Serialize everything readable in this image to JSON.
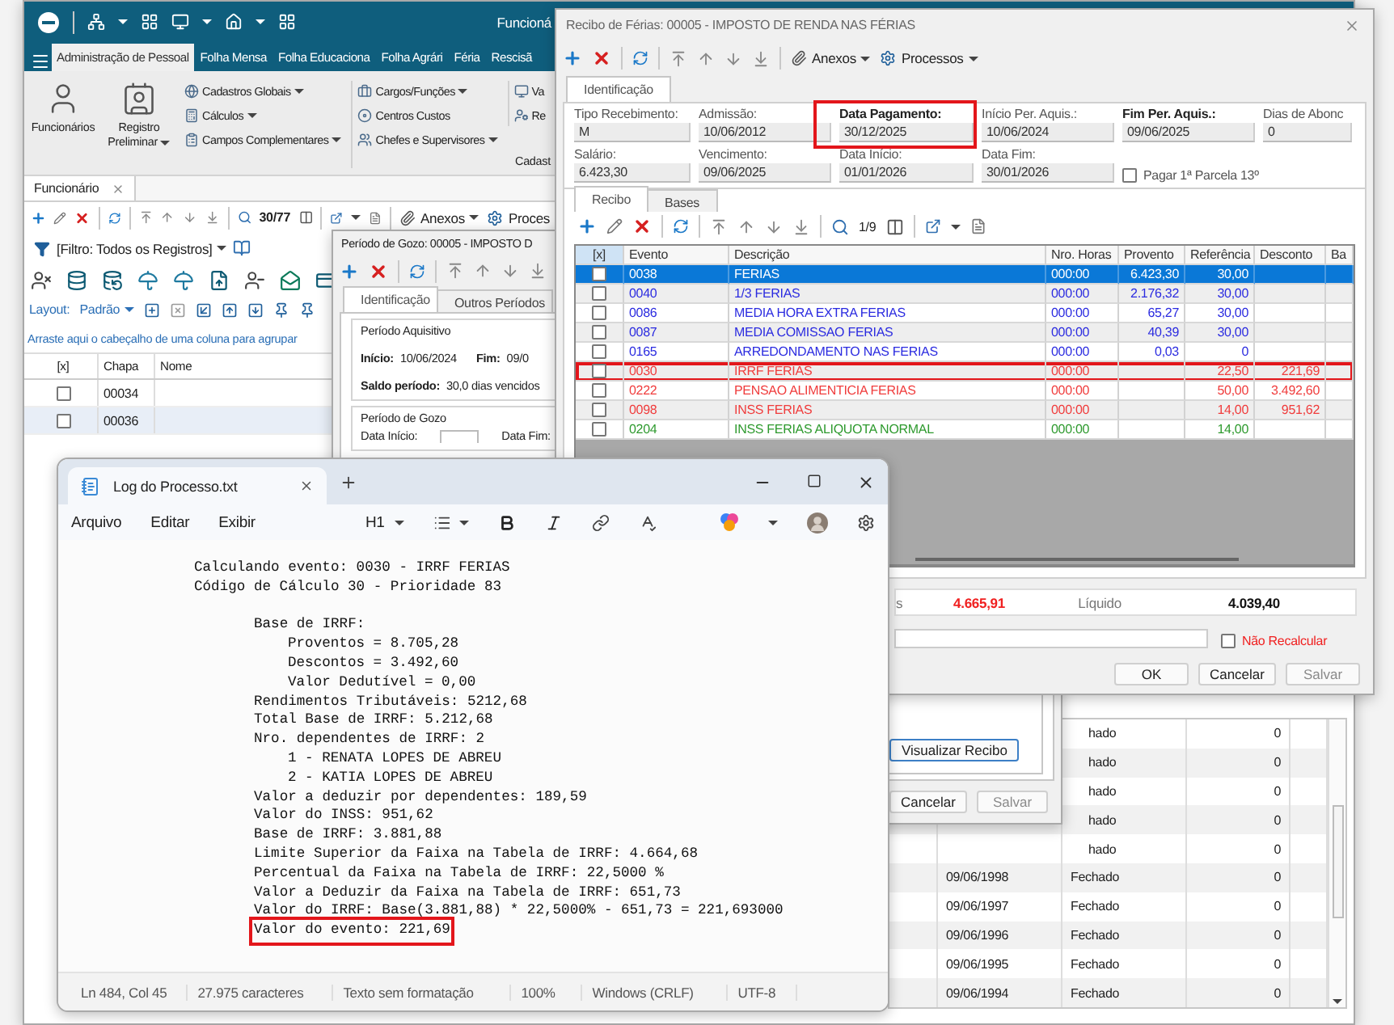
{
  "main_window": {
    "title": "Funcioná",
    "ribbon_tabs": [
      {
        "label": "Administração de Pessoal",
        "selected": true
      },
      {
        "label": "Folha Mensa",
        "selected": false
      },
      {
        "label": "Folha Educaciona",
        "selected": false
      },
      {
        "label": "Folha Agrári",
        "selected": false
      },
      {
        "label": "Féria",
        "selected": false
      },
      {
        "label": "Rescisã",
        "selected": false
      }
    ],
    "ribbon_buttons": [
      {
        "label": "Funcionários",
        "dropdown": false
      },
      {
        "label": "Registro Preliminar",
        "dropdown": true
      }
    ],
    "ribbon_columns": [
      {
        "items": [
          {
            "label": "Cadastros Globais",
            "dropdown": true
          },
          {
            "label": "Cálculos",
            "dropdown": true
          },
          {
            "label": "Campos Complementares",
            "dropdown": true
          }
        ]
      },
      {
        "items": [
          {
            "label": "Cargos/Funções",
            "dropdown": true
          },
          {
            "label": "Centros Custos",
            "dropdown": false
          },
          {
            "label": "Chefes e Supervisores",
            "dropdown": true
          }
        ]
      },
      {
        "items": [
          {
            "label": "Va",
            "dropdown": false
          },
          {
            "label": "Re",
            "dropdown": false
          }
        ]
      }
    ],
    "ribbon_group_label": "Cadast",
    "document_tab": "Funcionário",
    "toolbar": {
      "counter": "30/77",
      "attachments": "Anexos",
      "processes": "Proces"
    },
    "filter": "[Filtro: Todos os Registros]",
    "layout": {
      "label": "Layout:",
      "value": "Padrão"
    },
    "group_hint": "Arraste aqui o cabeçalho de uma coluna para agrupar",
    "grid": {
      "columns": [
        "[x]",
        "Chapa",
        "Nome"
      ],
      "rows": [
        {
          "chapa": "00034",
          "checked": false,
          "selected": false
        },
        {
          "chapa": "00036",
          "checked": false,
          "selected": true
        }
      ]
    },
    "periods": [
      {
        "kind": "cut",
        "status": "hado",
        "count": "0"
      },
      {
        "kind": "cut",
        "status": "hado",
        "count": "0"
      },
      {
        "kind": "cut",
        "status": "hado",
        "count": "0"
      },
      {
        "kind": "cut",
        "status": "hado",
        "count": "0"
      },
      {
        "kind": "cut",
        "status": "hado",
        "count": "0"
      },
      {
        "kind": "row",
        "date": "09/06/1998",
        "status": "Fechado",
        "count": "0"
      },
      {
        "kind": "row",
        "date": "09/06/1997",
        "status": "Fechado",
        "count": "0"
      },
      {
        "kind": "row",
        "date": "09/06/1996",
        "status": "Fechado",
        "count": "0"
      },
      {
        "kind": "row",
        "date": "09/06/1995",
        "status": "Fechado",
        "count": "0"
      },
      {
        "kind": "row",
        "date": "09/06/1994",
        "status": "Fechado",
        "count": "0"
      }
    ]
  },
  "period_window": {
    "title": "Período de Gozo: 00005 - IMPOSTO D",
    "tabs": [
      {
        "label": "Identificação",
        "selected": true
      },
      {
        "label": "Outros Períodos",
        "selected": false
      }
    ],
    "acquisition": {
      "title": "Período Aquisitivo",
      "start_label": "Início:",
      "start": "10/06/2024",
      "end_label": "Fim:",
      "end": "09/0",
      "balance_label": "Saldo período:",
      "balance": "30,0 dias vencidos"
    },
    "enjoyment": {
      "title": "Período de Gozo",
      "start_label": "Data Início:",
      "end_label": "Data Fim:"
    },
    "view_button": "Visualizar Recibo",
    "buttons": [
      {
        "label": "Cancelar",
        "disabled": false
      },
      {
        "label": "Salvar",
        "disabled": true
      }
    ]
  },
  "receipt_window": {
    "title": "Recibo de Férias: 00005 - IMPOSTO DE RENDA NAS FÉRIAS",
    "toolbar": {
      "attachments": "Anexos",
      "processes": "Processos"
    },
    "tab": "Identificação",
    "fields": [
      {
        "label": "Tipo Recebimento:",
        "value": "M",
        "bold": false,
        "highlighted": false
      },
      {
        "label": "Admissão:",
        "value": "10/06/2012",
        "bold": false,
        "highlighted": false
      },
      {
        "label": "Data Pagamento:",
        "value": "30/12/2025",
        "bold": true,
        "highlighted": true
      },
      {
        "label": "Início Per. Aquis.:",
        "value": "10/06/2024",
        "bold": false,
        "highlighted": false
      },
      {
        "label": "Fim Per. Aquis.:",
        "value": "09/06/2025",
        "bold": true,
        "highlighted": false
      },
      {
        "label": "Dias de Abonc",
        "value": "0",
        "bold": false,
        "highlighted": false
      },
      {
        "label": "Salário:",
        "value": "6.423,30",
        "bold": false,
        "highlighted": false
      },
      {
        "label": "Vencimento:",
        "value": "09/06/2025",
        "bold": false,
        "highlighted": false
      },
      {
        "label": "Data Início:",
        "value": "01/01/2026",
        "bold": false,
        "highlighted": false
      },
      {
        "label": "Data Fim:",
        "value": "30/01/2026",
        "bold": false,
        "highlighted": false
      }
    ],
    "first_installment": {
      "label": "Pagar 1ª Parcela 13º",
      "checked": false
    },
    "subtabs": [
      {
        "label": "Recibo",
        "selected": true
      },
      {
        "label": "Bases",
        "selected": false
      }
    ],
    "counter": "1/9",
    "columns": [
      "[x]",
      "Evento",
      "Descrição",
      "Nro. Horas",
      "Provento",
      "Referência",
      "Desconto",
      "Ba"
    ],
    "rows": [
      {
        "code": "0038",
        "description": "FERIAS",
        "hours": "000:00",
        "earning": "6.423,30",
        "reference": "30,00",
        "checked": false,
        "selected": true,
        "highlighted": false
      },
      {
        "code": "0040",
        "description": "1/3 FERIAS",
        "hours": "000:00",
        "earning": "2.176,32",
        "reference": "30,00",
        "color": "#2b2be0",
        "checked": false,
        "selected": false,
        "highlighted": false
      },
      {
        "code": "0086",
        "description": "MEDIA HORA EXTRA FERIAS",
        "hours": "000:00",
        "earning": "65,27",
        "reference": "30,00",
        "color": "#2b2be0",
        "checked": false,
        "selected": false,
        "highlighted": false
      },
      {
        "code": "0087",
        "description": "MEDIA COMISSAO FERIAS",
        "hours": "000:00",
        "earning": "40,39",
        "reference": "30,00",
        "color": "#2b2be0",
        "checked": false,
        "selected": false,
        "highlighted": false
      },
      {
        "code": "0165",
        "description": "ARREDONDAMENTO NAS FERIAS",
        "hours": "000:00",
        "earning": "0,03",
        "reference": "0",
        "color": "#2b2be0",
        "checked": false,
        "selected": false,
        "highlighted": false
      },
      {
        "code": "0030",
        "description": "IRRF FERIAS",
        "hours": "000:00",
        "reference": "22,50",
        "deduction": "221,69",
        "color": "#f03c3c",
        "checked": false,
        "selected": false,
        "highlighted": true
      },
      {
        "code": "0222",
        "description": "PENSAO ALIMENTICIA FERIAS",
        "hours": "000:00",
        "reference": "50,00",
        "deduction": "3.492,60",
        "color": "#f03c3c",
        "checked": false,
        "selected": false,
        "highlighted": false
      },
      {
        "code": "0098",
        "description": "INSS FERIAS",
        "hours": "000:00",
        "reference": "14,00",
        "deduction": "951,62",
        "color": "#f03c3c",
        "checked": false,
        "selected": false,
        "highlighted": false
      },
      {
        "code": "0204",
        "description": "INSS FERIAS ALIQUOTA NORMAL",
        "hours": "000:00",
        "reference": "14,00",
        "color": "#2e9a2e",
        "checked": false,
        "selected": false,
        "highlighted": false
      }
    ],
    "totals": [
      {
        "kind": "deduction",
        "label": "s",
        "value": "4.665,91"
      },
      {
        "kind": "net",
        "label": "Líquido",
        "value": "4.039,40"
      }
    ],
    "no_recalc": {
      "label": "Não Recalcular",
      "checked": false
    },
    "buttons": [
      {
        "label": "OK",
        "disabled": false
      },
      {
        "label": "Cancelar",
        "disabled": false
      },
      {
        "label": "Salvar",
        "disabled": true
      }
    ]
  },
  "notepad": {
    "tab_title": "Log do Processo.txt",
    "menu": [
      "Arquivo",
      "Editar",
      "Exibir"
    ],
    "heading": "H1",
    "lines": [
      {
        "text": "Calculando evento: 0030 - IRRF FERIAS",
        "highlighted": false
      },
      {
        "text": "Código de Cálculo 30 - Prioridade 83",
        "highlighted": false,
        "children": [
          {
            "text": "Base de IRRF:",
            "highlighted": false,
            "children": [
              {
                "text": "Proventos = 8.705,28",
                "highlighted": false
              },
              {
                "text": "Descontos = 3.492,60",
                "highlighted": false
              },
              {
                "text": "Valor Dedutível = 0,00",
                "highlighted": false
              }
            ]
          },
          {
            "text": "Rendimentos Tributáveis: 5212,68",
            "highlighted": false
          },
          {
            "text": "Total Base de IRRF: 5.212,68",
            "highlighted": false
          },
          {
            "text": "Nro. dependentes de IRRF: 2",
            "highlighted": false,
            "children": [
              {
                "text": "1 - RENATA LOPES DE ABREU",
                "highlighted": false
              },
              {
                "text": "2 - KATIA LOPES DE ABREU",
                "highlighted": false
              }
            ]
          },
          {
            "text": "Valor a deduzir por dependentes: 189,59",
            "highlighted": false
          },
          {
            "text": "Valor do INSS: 951,62",
            "highlighted": false
          },
          {
            "text": "Base de IRRF: 3.881,88",
            "highlighted": false
          },
          {
            "text": "Limite Superior da Faixa na Tabela de IRRF: 4.664,68",
            "highlighted": false
          },
          {
            "text": "Percentual da Faixa na Tabela de IRRF: 22,5000 %",
            "highlighted": false
          },
          {
            "text": "Valor a Deduzir da Faixa na Tabela de IRRF: 651,73",
            "highlighted": false
          },
          {
            "text": "Valor do IRRF: Base(3.881,88) * 22,5000% - 651,73 = 221,693000",
            "highlighted": false
          },
          {
            "text": "Valor do evento: 221,69",
            "highlighted": true
          }
        ]
      }
    ],
    "status": [
      "Ln 484, Col 45",
      "27.975 caracteres",
      "Texto sem formatação",
      "100%",
      "Windows (CRLF)",
      "UTF-8"
    ]
  }
}
